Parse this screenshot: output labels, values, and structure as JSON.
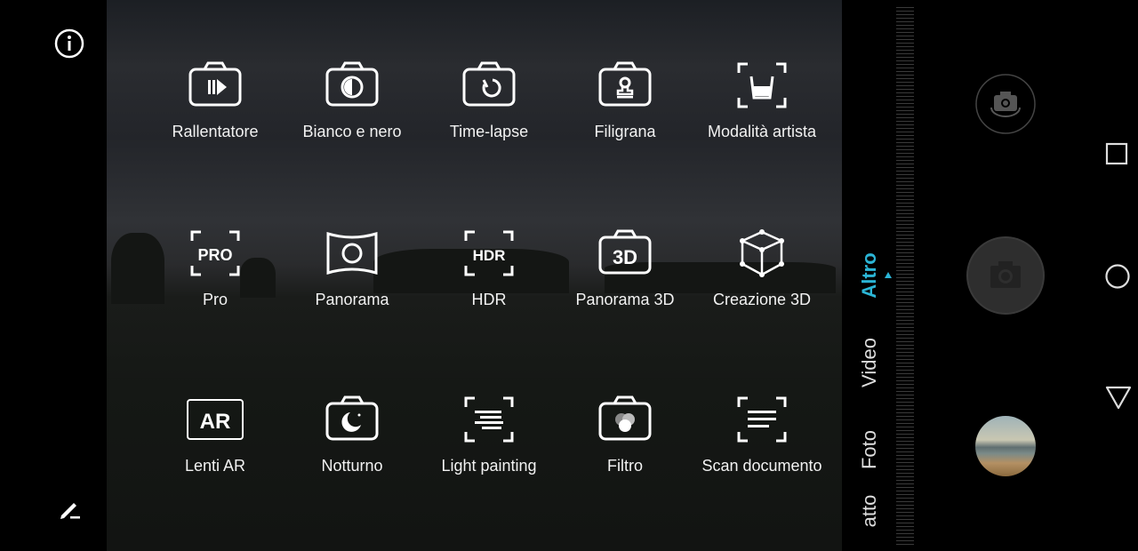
{
  "left": {
    "info_icon": "info-icon",
    "edit_icon": "edit-icon"
  },
  "modes": [
    {
      "label": "Rallentatore",
      "icon": "slow-motion-icon"
    },
    {
      "label": "Bianco e nero",
      "icon": "monochrome-icon"
    },
    {
      "label": "Time-lapse",
      "icon": "timelapse-icon"
    },
    {
      "label": "Filigrana",
      "icon": "watermark-stamp-icon"
    },
    {
      "label": "Modalità artista",
      "icon": "artist-cup-icon"
    },
    {
      "label": "Pro",
      "icon": "pro-icon"
    },
    {
      "label": "Panorama",
      "icon": "panorama-icon"
    },
    {
      "label": "HDR",
      "icon": "hdr-icon"
    },
    {
      "label": "Panorama 3D",
      "icon": "panorama-3d-icon"
    },
    {
      "label": "Creazione 3D",
      "icon": "cube-icon"
    },
    {
      "label": "Lenti AR",
      "icon": "ar-lens-icon",
      "glyph": "AR"
    },
    {
      "label": "Notturno",
      "icon": "night-moon-icon"
    },
    {
      "label": "Light painting",
      "icon": "light-painting-icon"
    },
    {
      "label": "Filtro",
      "icon": "filter-icon"
    },
    {
      "label": "Scan documento",
      "icon": "document-scan-icon"
    }
  ],
  "icon_text": {
    "pro": "PRO",
    "hdr": "HDR",
    "p3d": "3D",
    "ar": "AR"
  },
  "mode_switcher": {
    "items": [
      "Altro",
      "Video",
      "Foto",
      "atto"
    ],
    "selected": "Altro",
    "accent": "#2bb5d6"
  },
  "controls": {
    "switch_camera": "switch-camera-icon",
    "shutter": "shutter-icon",
    "gallery": "gallery-thumbnail"
  },
  "navbar": {
    "recents": "square-icon",
    "home": "circle-icon",
    "back": "triangle-back-icon"
  }
}
